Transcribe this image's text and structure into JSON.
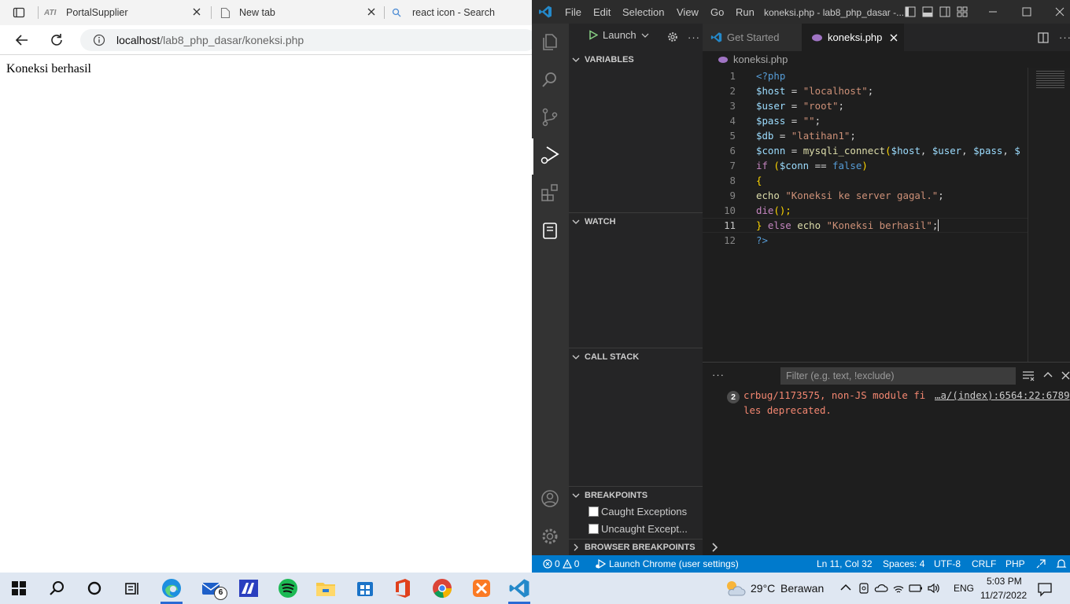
{
  "browser": {
    "tabs": [
      {
        "label": "PortalSupplier",
        "icon": "portal-logo"
      },
      {
        "label": "New tab",
        "icon": "page-icon"
      },
      {
        "label": "react icon - Search",
        "icon": "search-icon"
      }
    ],
    "url_host": "localhost",
    "url_path": "/lab8_php_dasar/koneksi.php",
    "page_text": "Koneksi berhasil"
  },
  "vscode": {
    "menu": [
      "File",
      "Edit",
      "Selection",
      "View",
      "Go",
      "Run"
    ],
    "window_title": "koneksi.php - lab8_php_dasar -...",
    "debug_config": "Launch",
    "sections": {
      "variables": "VARIABLES",
      "watch": "WATCH",
      "call_stack": "CALL STACK",
      "breakpoints": "BREAKPOINTS",
      "browser_breakpoints": "BROWSER BREAKPOINTS"
    },
    "breakpoint_items": [
      "Caught Exceptions",
      "Uncaught Except..."
    ],
    "editor_tabs": [
      {
        "label": "Get Started",
        "active": false
      },
      {
        "label": "koneksi.php",
        "active": true
      }
    ],
    "breadcrumb": "koneksi.php",
    "code": {
      "line_numbers": [
        "1",
        "2",
        "3",
        "4",
        "5",
        "6",
        "7",
        "8",
        "9",
        "10",
        "11",
        "12"
      ],
      "l1": "<?php",
      "l2a": "$host",
      "l2b": " = ",
      "l2c": "\"localhost\"",
      "l2d": ";",
      "l3a": "$user",
      "l3b": " = ",
      "l3c": "\"root\"",
      "l3d": ";",
      "l4a": "$pass",
      "l4b": " = ",
      "l4c": "\"\"",
      "l4d": ";",
      "l5a": "$db",
      "l5b": " = ",
      "l5c": "\"latihan1\"",
      "l5d": ";",
      "l6a": "$conn",
      "l6b": " = ",
      "l6c": "mysqli_connect",
      "l6d": "(",
      "l6e": "$host",
      "l6f": ", ",
      "l6g": "$user",
      "l6h": ", ",
      "l6i": "$pass",
      "l6j": ", ",
      "l6k": "$",
      "l7a": "if",
      "l7b": " (",
      "l7c": "$conn",
      "l7d": " == ",
      "l7e": "false",
      "l7f": ")",
      "l8": "{",
      "l9a": "echo",
      "l9b": " ",
      "l9c": "\"Koneksi ke server gagal.\"",
      "l9d": ";",
      "l10a": "die",
      "l10b": "();",
      "l11a": "}",
      "l11b": " else ",
      "l11c": "echo",
      "l11d": " ",
      "l11e": "\"Koneksi berhasil\"",
      "l11f": ";",
      "l12": "?>"
    },
    "panel": {
      "filter_placeholder": "Filter (e.g. text, !exclude)",
      "ellipsis": "···",
      "badge_count": "2",
      "msg_line1": "crbug/1173575, non-JS module fi",
      "msg_link": "…a/(index):6564:22:6789",
      "msg_line2": "les deprecated."
    },
    "status": {
      "errors": "0",
      "warnings": "0",
      "launch": "Launch Chrome (user settings)",
      "position": "Ln 11, Col 32",
      "spaces": "Spaces: 4",
      "encoding": "UTF-8",
      "eol": "CRLF",
      "language": "PHP"
    },
    "colors": {
      "accent": "#007acc",
      "sidebar": "#252526",
      "editor": "#1e1e1e",
      "activity": "#333333"
    }
  },
  "taskbar": {
    "weather_temp": "29°C",
    "weather_desc": "Berawan",
    "lang": "ENG",
    "time": "5:03 PM",
    "date": "11/27/2022",
    "mail_badge": "6"
  }
}
